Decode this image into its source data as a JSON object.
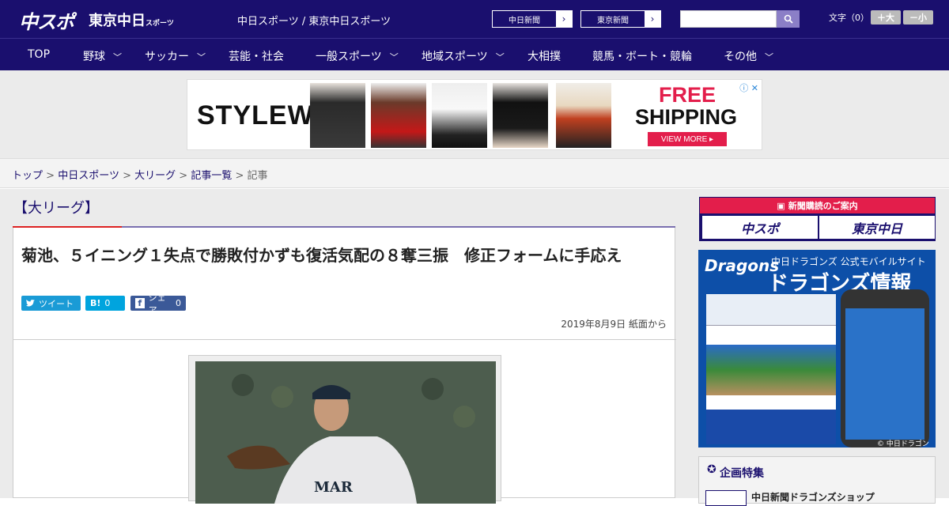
{
  "header": {
    "logo_main": "中スポ",
    "logo_sub": "東京中日",
    "logo_sub_small": "スポーツ",
    "site_names": "中日スポーツ / 東京中日スポーツ",
    "chunichi_shimbun": "中日新聞",
    "tokyo_shimbun": "東京新聞",
    "search_placeholder": "",
    "font_size_label": "文字（0）",
    "font_larger": "＋大",
    "font_smaller": "－小"
  },
  "nav": {
    "items": [
      {
        "label": "TOP",
        "dropdown": false
      },
      {
        "label": "野球",
        "dropdown": true
      },
      {
        "label": "サッカー",
        "dropdown": true
      },
      {
        "label": "芸能・社会",
        "dropdown": false
      },
      {
        "label": "一般スポーツ",
        "dropdown": true
      },
      {
        "label": "地域スポーツ",
        "dropdown": true
      },
      {
        "label": "大相撲",
        "dropdown": false
      },
      {
        "label": "競馬・ボート・競輪",
        "dropdown": false
      },
      {
        "label": "その他",
        "dropdown": true
      }
    ]
  },
  "ad": {
    "brand": "STYLEWE",
    "headline_1": "FREE",
    "headline_2": "SHIPPING",
    "cta": "VIEW MORE ▸",
    "info": "ⓘ ✕"
  },
  "breadcrumb": {
    "items": [
      "トップ",
      "中日スポーツ",
      "大リーグ",
      "記事一覧"
    ],
    "current": "記事",
    "separator": ">"
  },
  "article": {
    "category": "【大リーグ】",
    "title": "菊池、５イニング１失点で勝敗付かずも復活気配の８奪三振　修正フォームに手応え",
    "share": {
      "tweet_label": "ツイート",
      "hatena_label": "B!",
      "hatena_count": "0",
      "facebook_label": "シェア",
      "facebook_count": "0"
    },
    "date": "2019年8月9日 紙面から"
  },
  "sidebar": {
    "subscribe_heading": "新聞購読のご案内",
    "subscribe_left": "中スポ",
    "subscribe_right": "東京中日",
    "dragons_logo": "Dragons",
    "dragons_sub": "中日ドラゴンズ 公式モバイルサイト",
    "dragons_big": "ドラゴンズ情報",
    "dragons_footer": "© 中日ドラゴンズ",
    "feature_heading": "企画特集",
    "feature_item": "中日新聞ドラゴンズショップ"
  },
  "colors": {
    "brand_navy": "#1a0f6e",
    "accent_red": "#e31e4b",
    "share_blue": "#1a9bd6"
  }
}
